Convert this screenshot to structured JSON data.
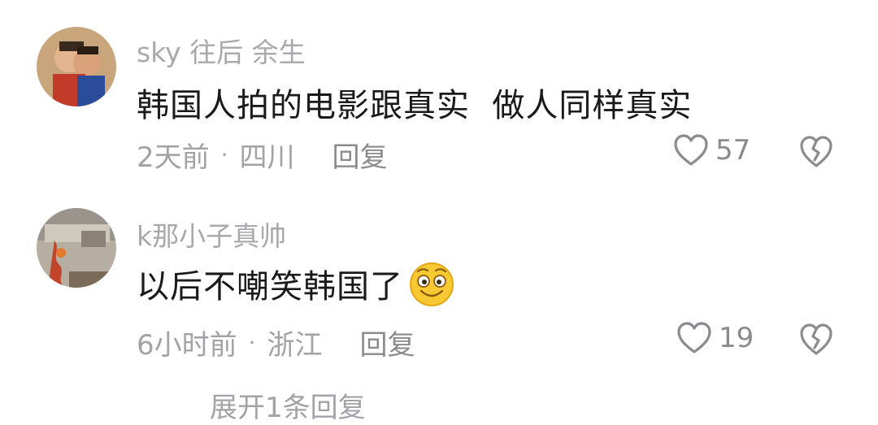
{
  "comments": [
    {
      "username": "sky 往后 余生",
      "text": "韩国人拍的电影跟真实  做人同样真实",
      "time": "2天前",
      "dot": "·",
      "location": "四川",
      "reply_label": "回复",
      "likes": "57",
      "avatar_icon": "avatar-photo"
    },
    {
      "username": "k那小子真帅",
      "text": "以后不嘲笑韩国了",
      "emoji_icon": "grinning-face-emoji",
      "time": "6小时前",
      "dot": "·",
      "location": "浙江",
      "reply_label": "回复",
      "likes": "19",
      "avatar_icon": "avatar-photo"
    }
  ],
  "expand_replies": "展开1条回复",
  "icons": {
    "like": "heart-icon",
    "dislike": "broken-heart-icon"
  },
  "colors": {
    "meta": "#a2a2a7",
    "text": "#1a1a1a",
    "icon": "#8a8a8f"
  }
}
